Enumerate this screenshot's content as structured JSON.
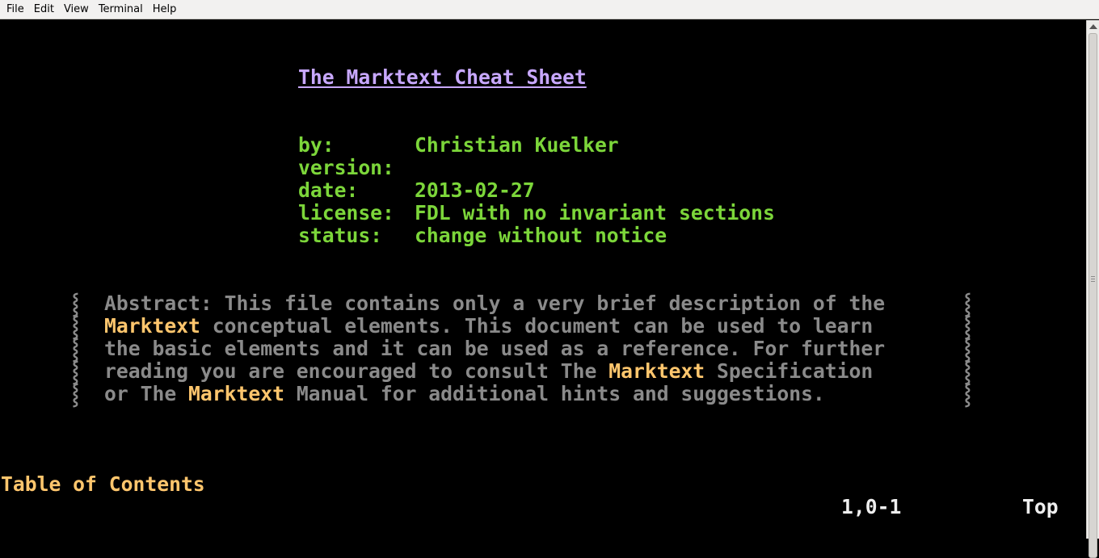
{
  "menubar": {
    "items": [
      "File",
      "Edit",
      "View",
      "Terminal",
      "Help"
    ]
  },
  "document": {
    "title": "The Marktext Cheat Sheet",
    "meta": [
      {
        "key": "by:",
        "value": "Christian Kuelker"
      },
      {
        "key": "version:",
        "value": ""
      },
      {
        "key": "date:",
        "value": "2013-02-27"
      },
      {
        "key": "license:",
        "value": "FDL with no invariant sections"
      },
      {
        "key": "status:",
        "value": "change without notice"
      }
    ],
    "abstract_marker": "⸾",
    "abstract_highlight": "Marktext",
    "abstract": {
      "l1": "Abstract: This file contains only a very brief description of the",
      "l2b": " conceptual elements. This document can be used to learn",
      "l3": "the basic elements and it can be used as a reference. For further",
      "l4a": "reading you are encouraged to consult The ",
      "l4c": " Specification",
      "l5a": "or The ",
      "l5c": " Manual for additional hints and suggestions."
    },
    "toc_heading": "Table of Contents"
  },
  "statusline": {
    "position": "1,0-1",
    "scroll": "Top"
  },
  "colors": {
    "title": "#c8a8ff",
    "meta": "#7cd63a",
    "abstract": "#8a8a8a",
    "highlight": "#ffc66d",
    "status": "#eeeeee",
    "background": "#000000"
  }
}
